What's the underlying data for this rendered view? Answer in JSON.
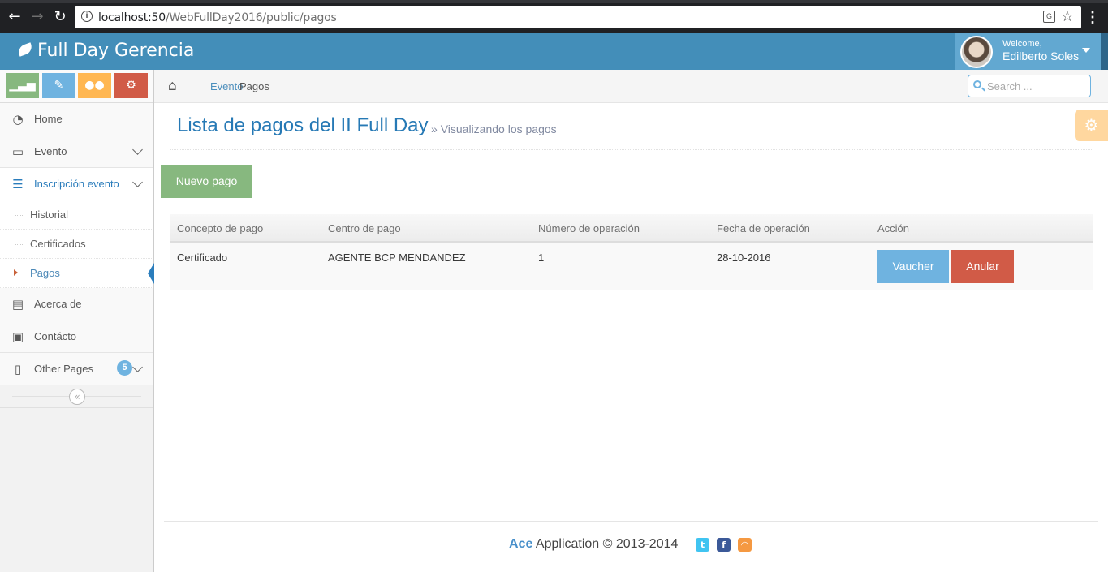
{
  "browser": {
    "url_host": "localhost:50",
    "url_path": "/WebFullDay2016/public/pagos"
  },
  "navbar": {
    "brand": "Full Day Gerencia",
    "welcome": "Welcome,",
    "user_name": "Edilberto Soles"
  },
  "sidebar": {
    "shortcuts": [
      {
        "name": "chart-icon",
        "color": "#87b87f"
      },
      {
        "name": "pencil-icon",
        "color": "#6fb3e0"
      },
      {
        "name": "users-icon",
        "color": "#ffb752"
      },
      {
        "name": "cogs-icon",
        "color": "#d15b47"
      }
    ],
    "items": [
      {
        "label": "Home",
        "icon": "tachometer-icon"
      },
      {
        "label": "Evento",
        "icon": "desktop-icon"
      },
      {
        "label": "Inscripción evento",
        "icon": "list-icon"
      },
      {
        "label": "Acerca de",
        "icon": "list-alt-icon"
      },
      {
        "label": "Contácto",
        "icon": "picture-icon"
      },
      {
        "label": "Other Pages",
        "icon": "file-icon",
        "badge": "5"
      }
    ],
    "subitems": [
      {
        "label": "Historial"
      },
      {
        "label": "Certificados"
      },
      {
        "label": "Pagos"
      }
    ]
  },
  "breadcrumbs": {
    "items": [
      "Evento",
      "Pagos"
    ]
  },
  "search": {
    "placeholder": "Search ..."
  },
  "page": {
    "title": "Lista de pagos del II Full Day",
    "subtitle": "Visualizando los pagos",
    "new_button": "Nuevo pago"
  },
  "table": {
    "headers": [
      "Concepto de pago",
      "Centro de pago",
      "Número de operación",
      "Fecha de operación",
      "Acción"
    ],
    "rows": [
      {
        "concepto": "Certificado",
        "centro": "AGENTE BCP MENDANDEZ",
        "numero": "1",
        "fecha": "28-10-2016"
      }
    ],
    "actions": {
      "view": "Vaucher",
      "cancel": "Anular"
    }
  },
  "footer": {
    "brand": "Ace",
    "text": "Application © 2013-2014"
  }
}
